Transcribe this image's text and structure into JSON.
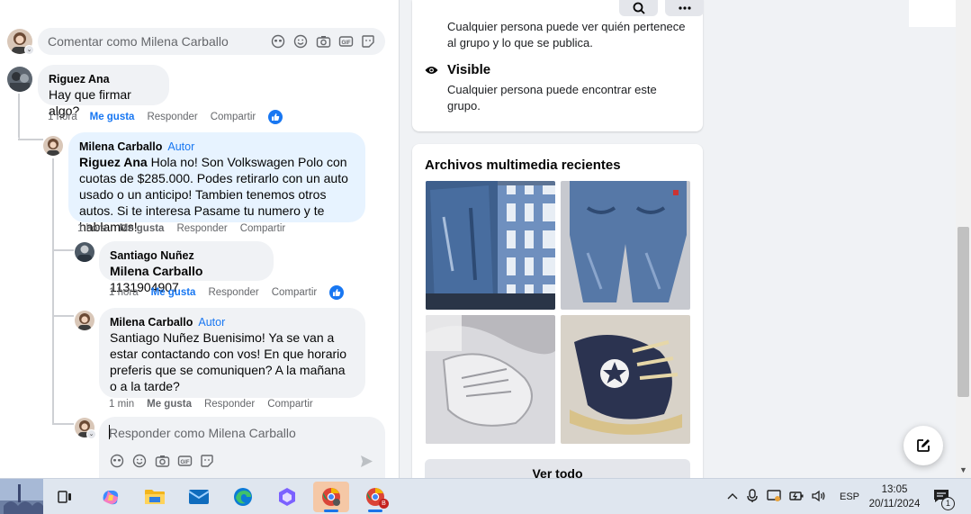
{
  "composer": {
    "placeholder": "Comentar como Milena Carballo"
  },
  "comments": [
    {
      "author": "Riguez Ana",
      "text": "Hay que firmar algo?",
      "time": "1 hora",
      "like": "Me gusta",
      "reply": "Responder",
      "share": "Compartir"
    },
    {
      "author": "Milena Carballo",
      "badge": "Autor",
      "mention": "Riguez Ana",
      "text": " Hola no! Son Volkswagen Polo con cuotas de $285.000. Podes retirarlo con un auto usado o un anticipo! Tambien tenemos otros autos. Si te interesa Pasame tu numero y te hablamos!",
      "time": "1 hora",
      "like": "Me gusta",
      "reply": "Responder",
      "share": "Compartir"
    },
    {
      "author": "Santiago Nuñez",
      "mention": "Milena Carballo",
      "text": " 1131904907",
      "time": "1 hora",
      "like": "Me gusta",
      "reply": "Responder",
      "share": "Compartir"
    },
    {
      "author": "Milena Carballo",
      "badge": "Autor",
      "text": "Santiago Nuñez Buenisimo! Ya se van a estar contactando con vos! En que horario preferis que se comuniquen? A la mañana o a la tarde?",
      "time": "1 min",
      "like": "Me gusta",
      "reply": "Responder",
      "share": "Compartir"
    }
  ],
  "reply_box": {
    "placeholder": "Responder como Milena Carballo"
  },
  "about": {
    "public_desc": "Cualquier persona puede ver quién pertenece al grupo y lo que se publica.",
    "visible_title": "Visible",
    "visible_desc": "Cualquier persona puede encontrar este grupo."
  },
  "media": {
    "title": "Archivos multimedia recientes",
    "see_all": "Ver todo"
  },
  "taskbar": {
    "language": "ESP",
    "time": "13:05",
    "date": "20/11/2024",
    "notifications": "1",
    "chrome_badge": "B"
  },
  "colors": {
    "link_blue": "#1877f2",
    "bubble": "#f0f2f5",
    "author_bubble": "#e7f3ff"
  }
}
